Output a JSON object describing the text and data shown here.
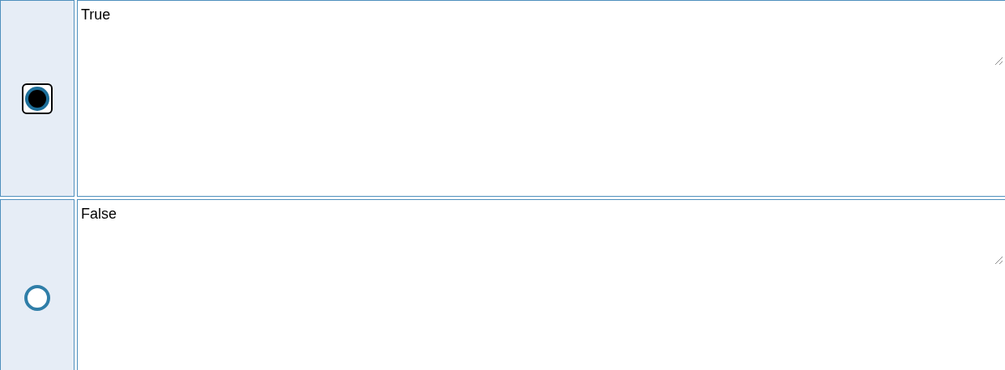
{
  "options": [
    {
      "text": "True",
      "selected": true
    },
    {
      "text": "False",
      "selected": false
    }
  ]
}
